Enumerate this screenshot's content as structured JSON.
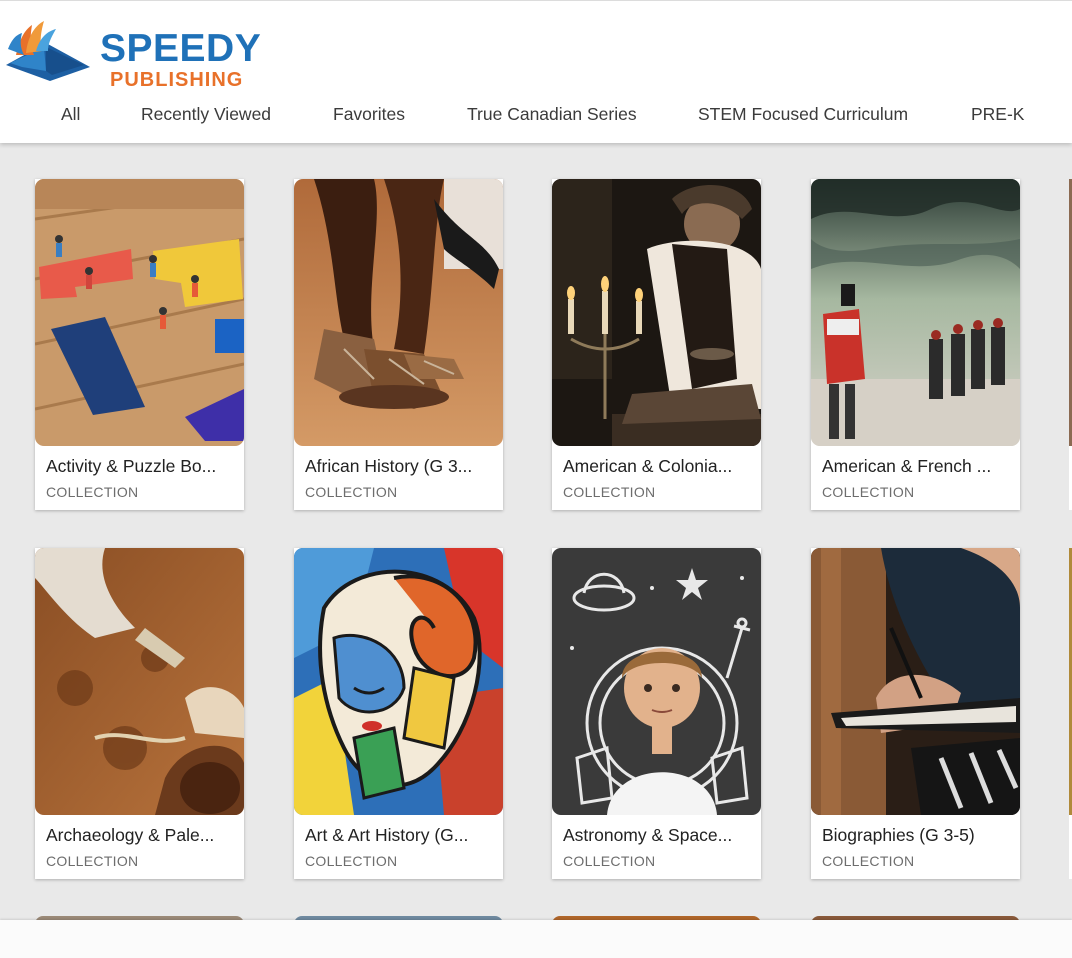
{
  "brand": {
    "line1": "SPEEDY",
    "line2": "PUBLISHING",
    "logo_icon": "book-logo-icon",
    "colors": {
      "blue": "#1f71b8",
      "orange": "#e8712a"
    }
  },
  "nav": {
    "tabs": [
      {
        "label": "All"
      },
      {
        "label": "Recently Viewed"
      },
      {
        "label": "Favorites"
      },
      {
        "label": "True Canadian Series"
      },
      {
        "label": "STEM Focused Curriculum"
      },
      {
        "label": "PRE-K"
      }
    ]
  },
  "collections": [
    {
      "title": "Activity & Puzzle Bo...",
      "type": "COLLECTION",
      "image": "wooden-puzzle-blocks-with-tiny-figures"
    },
    {
      "title": "African History (G 3...",
      "type": "COLLECTION",
      "image": "dancers-feet-in-sandals"
    },
    {
      "title": "American & Colonia...",
      "type": "COLLECTION",
      "image": "colonial-man-by-candlelight"
    },
    {
      "title": "American & French ...",
      "type": "COLLECTION",
      "image": "marching-soldiers-stormy-sky"
    },
    {
      "title": "Archaeology & Pale...",
      "type": "COLLECTION",
      "image": "excavation-dig-site"
    },
    {
      "title": "Art & Art History (G...",
      "type": "COLLECTION",
      "image": "cubist-colorful-face-painting"
    },
    {
      "title": "Astronomy & Space...",
      "type": "COLLECTION",
      "image": "boy-with-chalk-astronaut-helmet"
    },
    {
      "title": "Biographies (G 3-5)",
      "type": "COLLECTION",
      "image": "person-writing-in-notebook"
    }
  ]
}
